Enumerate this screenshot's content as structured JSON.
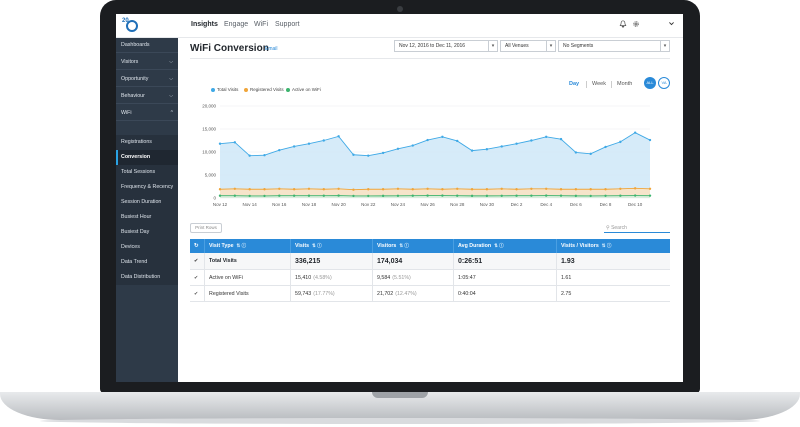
{
  "nav": {
    "logo_text": "20",
    "items": [
      "Insights",
      "Engage",
      "WiFi",
      "Support"
    ],
    "icons": [
      "bell-icon",
      "gear-icon",
      "chevron-down-icon"
    ]
  },
  "sidebar": {
    "groups": [
      {
        "label": "Dashboards"
      },
      {
        "label": "Visitors"
      },
      {
        "label": "Opportunity"
      },
      {
        "label": "Behaviour"
      },
      {
        "label": "WiFi"
      }
    ],
    "sub_items": [
      "Registrations",
      "Conversion",
      "Total Sessions",
      "Frequency & Recency",
      "Session Duration",
      "Busiest Hour",
      "Busiest Day",
      "Devices",
      "Data Trend",
      "Data Distribution"
    ],
    "current": "Conversion"
  },
  "header": {
    "title": "WiFi Conversion",
    "email_link": "Email",
    "date_range": "Nov 12, 2016 to Dec 11, 2016",
    "venue": "All Venues",
    "segment": "No Segments"
  },
  "period": {
    "options": [
      "Day",
      "Week",
      "Month"
    ],
    "active": "Day",
    "buttons": [
      "ALL",
      "VA"
    ]
  },
  "chart_data": {
    "type": "area",
    "x": [
      "Nov 12",
      "Nov 13",
      "Nov 14",
      "Nov 15",
      "Nov 16",
      "Nov 17",
      "Nov 18",
      "Nov 19",
      "Nov 20",
      "Nov 21",
      "Nov 22",
      "Nov 23",
      "Nov 24",
      "Nov 25",
      "Nov 26",
      "Nov 27",
      "Nov 28",
      "Nov 29",
      "Nov 30",
      "Dec 1",
      "Dec 2",
      "Dec 3",
      "Dec 4",
      "Dec 5",
      "Dec 6",
      "Dec 7",
      "Dec 8",
      "Dec 9",
      "Dec 10",
      "Dec 11"
    ],
    "tick_labels": [
      "Nov 12",
      "Nov 14",
      "Nov 16",
      "Nov 18",
      "Nov 20",
      "Nov 22",
      "Nov 24",
      "Nov 26",
      "Nov 28",
      "Nov 30",
      "Dec 2",
      "Dec 4",
      "Dec 6",
      "Dec 8",
      "Dec 10"
    ],
    "y_ticks": [
      "20,000",
      "15,000",
      "10,000",
      "5,000",
      "0"
    ],
    "ylim": [
      0,
      20000
    ],
    "series": [
      {
        "name": "Total Visits",
        "color": "#3fa9e6",
        "fill": "#cfe8f8",
        "values": [
          11800,
          12100,
          9200,
          9300,
          10400,
          11200,
          11800,
          12500,
          13400,
          9400,
          9200,
          9800,
          10700,
          11400,
          12600,
          13300,
          12400,
          10300,
          10600,
          11200,
          11800,
          12500,
          13300,
          12800,
          9900,
          9600,
          11100,
          12200,
          14200,
          12600
        ]
      },
      {
        "name": "Registered Visits",
        "color": "#f0a53a",
        "fill": "#fbe3c2",
        "values": [
          1900,
          2000,
          1900,
          1900,
          2000,
          1900,
          2000,
          1900,
          2000,
          1800,
          1900,
          1900,
          2000,
          1900,
          2000,
          1900,
          2000,
          1900,
          1900,
          2000,
          1900,
          2000,
          2000,
          1900,
          1900,
          1900,
          1900,
          2000,
          2100,
          2000
        ]
      },
      {
        "name": "Active on WiFi",
        "color": "#3cb46e",
        "fill": "#d6efdf",
        "values": [
          500,
          500,
          450,
          450,
          500,
          500,
          500,
          500,
          520,
          450,
          450,
          460,
          480,
          500,
          520,
          520,
          500,
          460,
          460,
          480,
          500,
          510,
          520,
          510,
          460,
          450,
          480,
          500,
          540,
          510
        ]
      }
    ]
  },
  "toolbar": {
    "print_label": "Print Rows",
    "search_placeholder": "Search"
  },
  "table": {
    "headers": [
      "Visit Type",
      "Visits",
      "Visitors",
      "Avg Duration",
      "Visits / Visitors"
    ],
    "rows": [
      {
        "type": "Total Visits",
        "visits": "336,215",
        "visits_pct": "",
        "visitors": "174,034",
        "visitors_pct": "",
        "duration": "0:26:51",
        "ratio": "1.93"
      },
      {
        "type": "Active on WiFi",
        "visits": "15,410",
        "visits_pct": "(4.58%)",
        "visitors": "9,584",
        "visitors_pct": "(5.51%)",
        "duration": "1:05:47",
        "ratio": "1.61"
      },
      {
        "type": "Registered Visits",
        "visits": "59,743",
        "visits_pct": "(17.77%)",
        "visitors": "21,702",
        "visitors_pct": "(12.47%)",
        "duration": "0:40:04",
        "ratio": "2.75"
      }
    ]
  }
}
